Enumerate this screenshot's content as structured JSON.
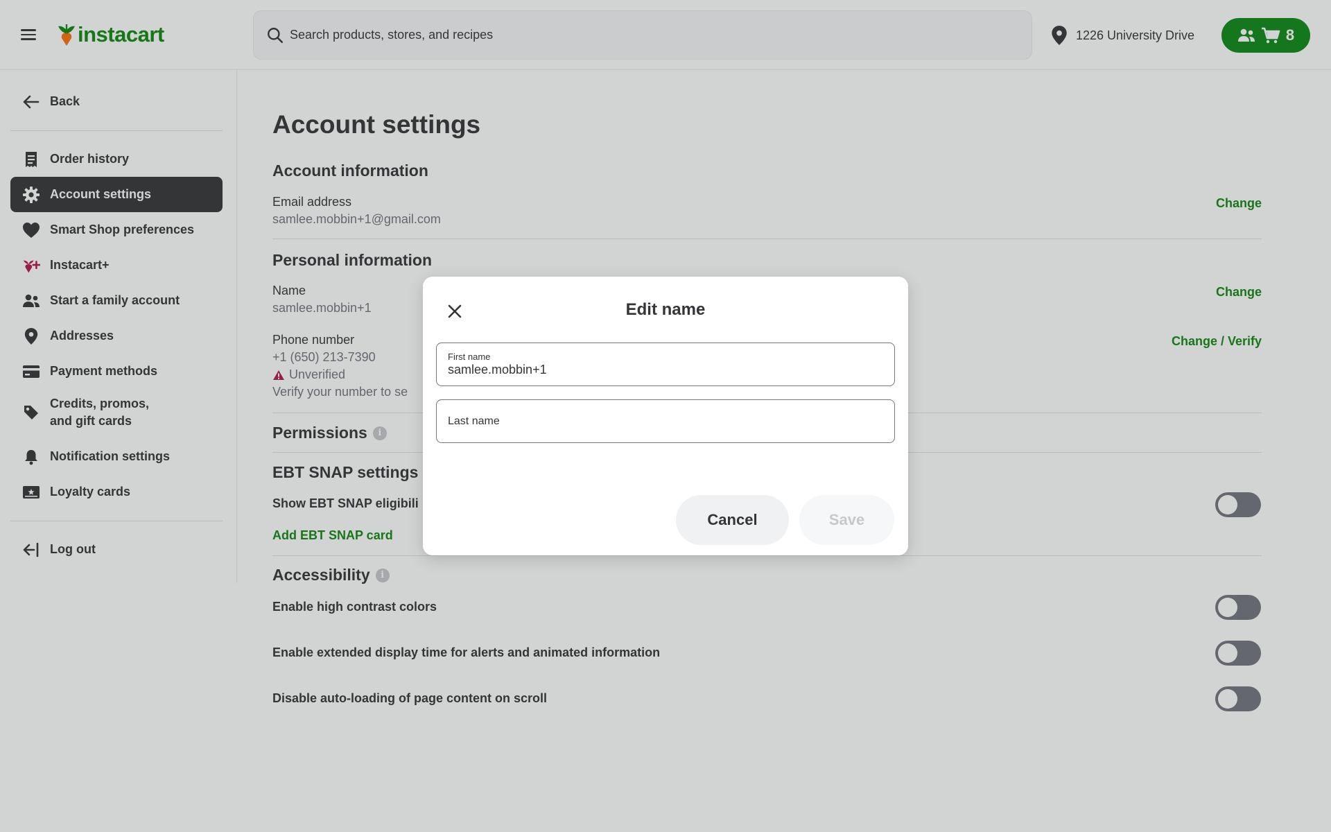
{
  "header": {
    "logo_text": "instacart",
    "search_placeholder": "Search products, stores, and recipes",
    "address": "1226 University Drive",
    "cart_count": "8",
    "brand_color": "#108910"
  },
  "sidebar": {
    "back_label": "Back",
    "items": [
      {
        "label": "Order history",
        "icon": "receipt-icon"
      },
      {
        "label": "Account settings",
        "icon": "gear-icon",
        "active": true
      },
      {
        "label": "Smart Shop preferences",
        "icon": "heart-icon"
      },
      {
        "label": "Instacart+",
        "icon": "instacart-plus-icon"
      },
      {
        "label": "Start a family account",
        "icon": "family-icon"
      },
      {
        "label": "Addresses",
        "icon": "location-pin-icon"
      },
      {
        "label": "Payment methods",
        "icon": "credit-card-icon"
      },
      {
        "label": "Credits, promos,",
        "label2": "and gift cards",
        "icon": "tag-icon"
      },
      {
        "label": "Notification settings",
        "icon": "bell-icon"
      },
      {
        "label": "Loyalty cards",
        "icon": "loyalty-card-icon"
      }
    ],
    "logout_label": "Log out"
  },
  "main": {
    "title": "Account settings",
    "account_info": {
      "heading": "Account information",
      "email_label": "Email address",
      "email_value": "samlee.mobbin+1@gmail.com",
      "change_label": "Change"
    },
    "personal_info": {
      "heading": "Personal information",
      "name_label": "Name",
      "name_value": "samlee.mobbin+1",
      "name_change_label": "Change",
      "phone_label": "Phone number",
      "phone_value": "+1 (650) 213-7390",
      "phone_status": "Unverified",
      "phone_note": "Verify your number to se",
      "phone_change_label": "Change / Verify"
    },
    "permissions": {
      "heading": "Permissions"
    },
    "ebt": {
      "heading": "EBT SNAP settings",
      "show_label": "Show EBT SNAP eligibili",
      "add_card_label": "Add EBT SNAP card"
    },
    "accessibility": {
      "heading": "Accessibility",
      "options": [
        "Enable high contrast colors",
        "Enable extended display time for alerts and animated information",
        "Disable auto-loading of page content on scroll"
      ]
    }
  },
  "modal": {
    "title": "Edit name",
    "first_name_label": "First name",
    "first_name_value": "samlee.mobbin+1",
    "last_name_placeholder": "Last name",
    "cancel_label": "Cancel",
    "save_label": "Save"
  }
}
